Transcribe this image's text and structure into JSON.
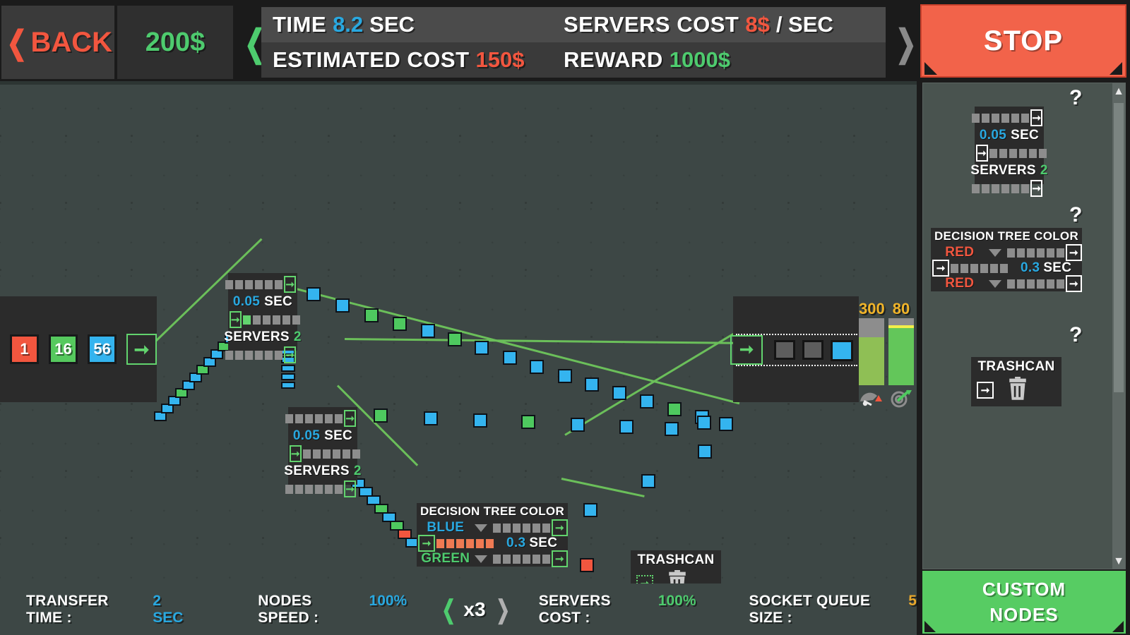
{
  "header": {
    "back_label": "BACK",
    "back_icon": "chevron-left-icon",
    "money": "200$",
    "prev_icon": "chevron-left-icon",
    "next_icon": "chevron-right-icon",
    "stats": [
      {
        "key": "TIME",
        "value": "8.2",
        "unit": "SEC",
        "value_color": "blue"
      },
      {
        "key": "SERVERS COST",
        "value": "8$",
        "unit": "/ SEC",
        "value_color": "red"
      },
      {
        "key": "ESTIMATED COST",
        "value": "150$",
        "unit": "",
        "value_color": "red"
      },
      {
        "key": "REWARD",
        "value": "1000$",
        "unit": "",
        "value_color": "green"
      }
    ],
    "stop_label": "STOP"
  },
  "footer": {
    "transfer_time_label": "TRANSFER TIME :",
    "transfer_time_value": "2 SEC",
    "nodes_speed_label": "NODES SPEED :",
    "nodes_speed_value": "100%",
    "speed_prev_icon": "chevron-left-icon",
    "speed_value": "x3",
    "speed_next_icon": "chevron-right-icon",
    "servers_cost_label": "SERVERS COST :",
    "servers_cost_value": "100%",
    "socket_queue_label": "SOCKET QUEUE SIZE :",
    "socket_queue_value": "5"
  },
  "palette": {
    "help_icon": "question-mark-icon",
    "scroll_up_icon": "triangle-up-icon",
    "scroll_down_icon": "triangle-down-icon",
    "items": [
      {
        "type": "server",
        "time_value": "0.05",
        "time_unit": "SEC",
        "servers_label": "SERVERS",
        "servers_count": "2"
      },
      {
        "type": "decision-tree",
        "title": "DECISION TREE COLOR",
        "option_top": "RED",
        "option_bottom": "RED",
        "time_value": "0.3",
        "time_unit": "SEC"
      },
      {
        "type": "trashcan",
        "title": "TRASHCAN",
        "icon": "trash-icon"
      }
    ]
  },
  "custom_nodes": {
    "line1": "CUSTOM",
    "line2": "NODES"
  },
  "canvas": {
    "input_node": {
      "badges": [
        {
          "label": "1",
          "color": "red"
        },
        {
          "label": "16",
          "color": "green"
        },
        {
          "label": "56",
          "color": "blue"
        }
      ],
      "out_port_icon": "arrow-right-icon"
    },
    "server_node_1": {
      "time_value": "0.05",
      "time_unit": "SEC",
      "servers_label": "SERVERS",
      "servers_count": "2"
    },
    "server_node_2": {
      "time_value": "0.05",
      "time_unit": "SEC",
      "servers_label": "SERVERS",
      "servers_count": "2"
    },
    "decision_tree": {
      "title": "DECISION TREE COLOR",
      "option_top": "BLUE",
      "option_bottom": "GREEN",
      "time_value": "0.3",
      "time_unit": "SEC"
    },
    "trashcan": {
      "title": "TRASHCAN",
      "icon": "trash-icon"
    },
    "output_node": {
      "in_port_icon": "arrow-right-icon",
      "gauges": [
        {
          "label": "300",
          "fill_pct": 72,
          "color": "#8fbf55",
          "marker": false
        },
        {
          "label": "80",
          "fill_pct": 88,
          "color": "#63c65a",
          "marker": true
        }
      ],
      "speed_icon": "speedometer-icon",
      "target_icon": "target-icon"
    }
  },
  "colors": {
    "accent_green": "#4ecb6e",
    "accent_red": "#f2563f",
    "accent_blue": "#29a8e0",
    "accent_gold": "#e8a72c",
    "canvas_bg": "#3d4745",
    "node_bg": "#2b2b2b"
  }
}
